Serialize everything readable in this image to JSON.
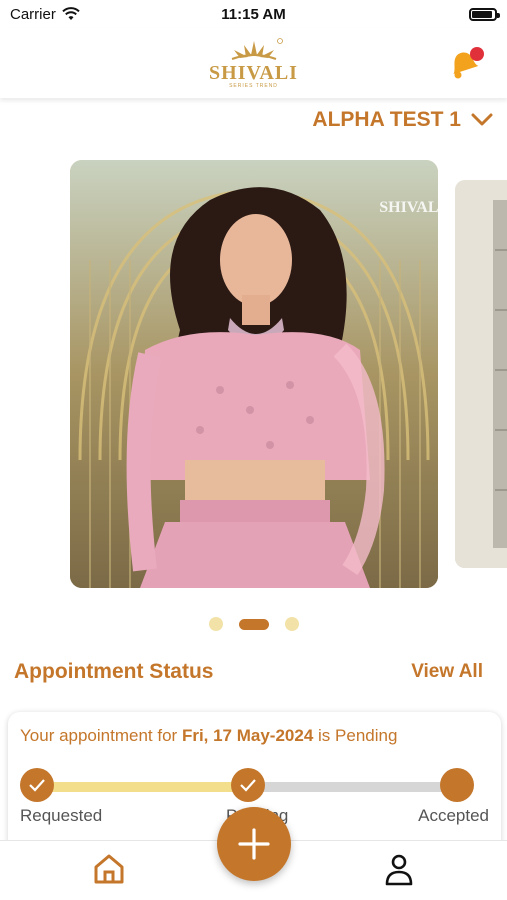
{
  "status_bar": {
    "carrier": "Carrier",
    "time": "11:15 AM"
  },
  "header": {
    "logo_text": "SHIVALI",
    "logo_tagline": "SERIES TREND",
    "logo_registered": "®"
  },
  "account": {
    "name": "ALPHA TEST 1"
  },
  "carousel": {
    "slide_count": 3,
    "active_index": 1,
    "watermark": "SHIVALI"
  },
  "appointment": {
    "section_title": "Appointment Status",
    "view_all": "View All",
    "message_prefix": "Your appointment for ",
    "date": "Fri, 17 May-2024",
    "message_suffix": " is Pending",
    "steps": [
      "Requested",
      "Pending",
      "Accepted"
    ],
    "progress_fraction": 0.5
  },
  "colors": {
    "accent": "#c4762a",
    "gold": "#c89a45",
    "progress_fill": "#f3de8b",
    "track": "#d6d6d6",
    "notification": "#e0303a"
  },
  "icons": {
    "bell": "bell-icon",
    "home": "home-icon",
    "profile": "person-icon",
    "add": "plus-icon",
    "dropdown": "chevron-down-icon"
  }
}
